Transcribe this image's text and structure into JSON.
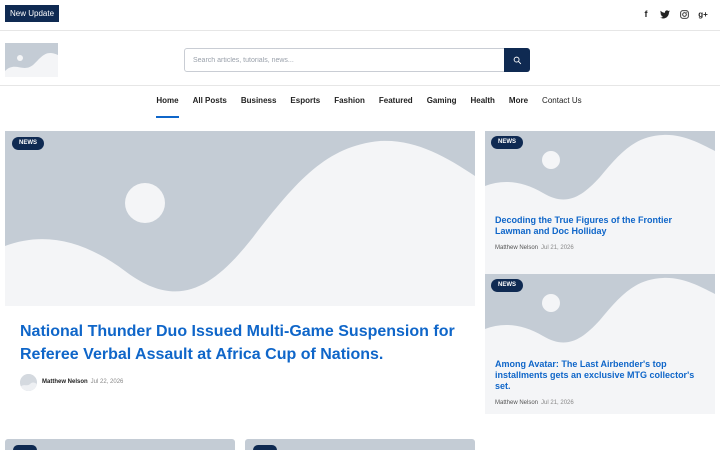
{
  "topbar": {
    "badge": "New Update"
  },
  "socials": [
    {
      "name": "facebook-icon",
      "glyph": "f"
    },
    {
      "name": "twitter-icon",
      "glyph": "t"
    },
    {
      "name": "instagram-icon",
      "glyph": "◎"
    },
    {
      "name": "google-plus-icon",
      "glyph": "g+"
    }
  ],
  "search": {
    "placeholder": "Search articles, tutorials, news..."
  },
  "nav": [
    "Home",
    "All Posts",
    "Business",
    "Esports",
    "Fashion",
    "Featured",
    "Gaming",
    "Health",
    "More",
    "Contact Us"
  ],
  "hero": {
    "tag": "NEWS",
    "title": "National Thunder Duo Issued Multi-Game Suspension for Referee Verbal Assault at Africa Cup of Nations.",
    "author": "Matthew Nelson",
    "date": "Jul 22, 2026"
  },
  "side": [
    {
      "tag": "NEWS",
      "title": "Decoding the True Figures of the Frontier Lawman and Doc Holliday",
      "author": "Matthew Nelson",
      "date": "Jul 21, 2026"
    },
    {
      "tag": "NEWS",
      "title": "Among Avatar: The Last Airbender's top installments gets an exclusive MTG collector's set.",
      "author": "Matthew Nelson",
      "date": "Jul 21, 2026"
    }
  ],
  "colors": {
    "navy": "#0f2a52",
    "link_blue": "#0f66c9",
    "placeholder_gray": "#c4ccd5"
  }
}
